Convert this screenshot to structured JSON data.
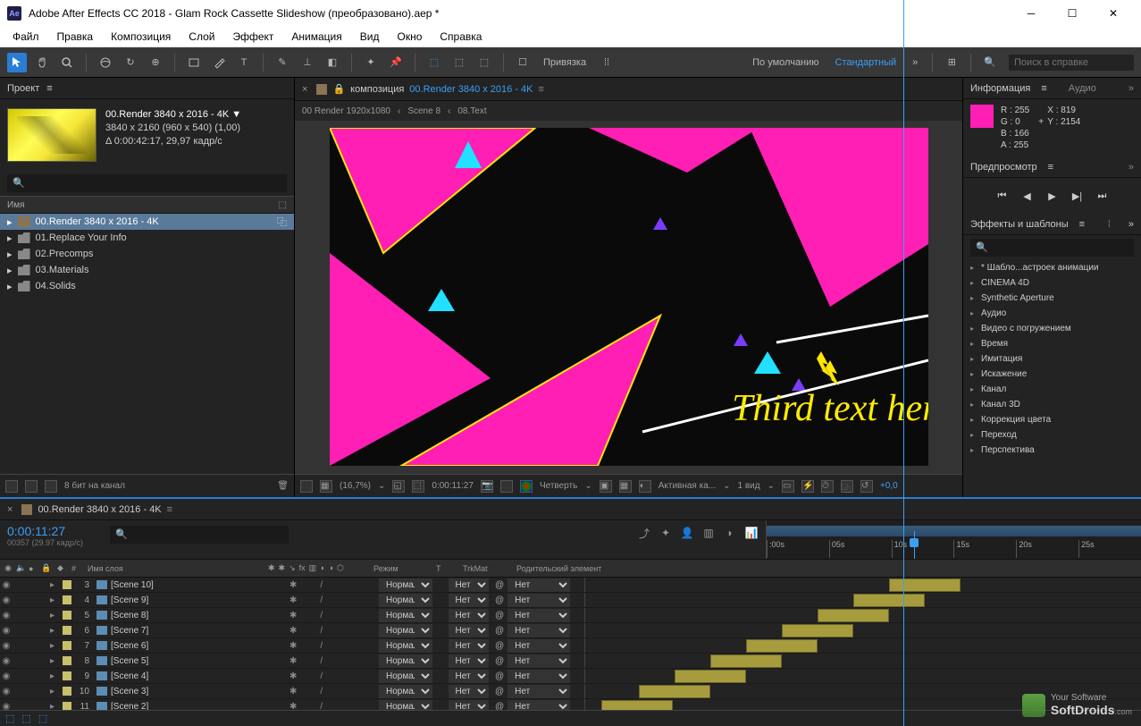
{
  "app": {
    "title": "Adobe After Effects CC 2018 - Glam Rock Cassette Slideshow (преобразовано).aep *"
  },
  "menu": [
    "Файл",
    "Правка",
    "Композиция",
    "Слой",
    "Эффект",
    "Анимация",
    "Вид",
    "Окно",
    "Справка"
  ],
  "toolbar": {
    "snap": "Привязка",
    "workspace_default": "По умолчанию",
    "workspace_standard": "Стандартный",
    "search_placeholder": "Поиск в справке"
  },
  "project": {
    "panel_title": "Проект",
    "selected_name": "00.Render 3840 x 2016 - 4K ▼",
    "dims": "3840 x 2160  (960 x 540) (1,00)",
    "duration": "Δ 0:00:42:17, 29,97 кадр/с",
    "search_placeholder": "",
    "list_header": "Имя",
    "items": [
      {
        "name": "00.Render 3840 x 2016 - 4K",
        "type": "comp",
        "selected": true
      },
      {
        "name": "01.Replace Your Info",
        "type": "folder"
      },
      {
        "name": "02.Precomps",
        "type": "folder"
      },
      {
        "name": "03.Materials",
        "type": "folder"
      },
      {
        "name": "04.Solids",
        "type": "folder"
      }
    ],
    "footer_bpc": "8 бит на канал"
  },
  "comp": {
    "tab_label": "композиция",
    "tab_name": "00.Render 3840 x 2016 - 4K",
    "breadcrumb": [
      "00 Render 1920x1080",
      "Scene 8",
      "08.Text"
    ],
    "overlay_text": "Third text her",
    "zoom": "(16,7%)",
    "time": "0:00:11:27",
    "res": "Четверть",
    "camera": "Активная ка...",
    "views": "1 вид",
    "offset": "+0,0"
  },
  "info": {
    "panel_title": "Информация",
    "audio_tab": "Аудио",
    "r": "255",
    "g": "0",
    "b": "166",
    "a": "255",
    "x": "819",
    "y": "2154"
  },
  "preview": {
    "panel_title": "Предпросмотр"
  },
  "effects": {
    "panel_title": "Эффекты и шаблоны",
    "items": [
      "* Шабло...астроек анимации",
      "CINEMA 4D",
      "Synthetic Aperture",
      "Аудио",
      "Видео с погружением",
      "Время",
      "Имитация",
      "Искажение",
      "Канал",
      "Канал 3D",
      "Коррекция цвета",
      "Переход",
      "Перспектива"
    ]
  },
  "timeline": {
    "tab_name": "00.Render 3840 x 2016 - 4K",
    "timecode": "0:00:11:27",
    "frames": "00357 (29.97 кадр/с)",
    "hdr_name": "Имя слоя",
    "hdr_mode": "Режим",
    "hdr_trkmat": "TrkMat",
    "hdr_parent": "Родительский элемент",
    "mode_value": "Нормаль",
    "none_value": "Нет",
    "ticks": [
      ":00s",
      "05s",
      "10s",
      "15s",
      "20s",
      "25s"
    ],
    "layers": [
      {
        "num": 3,
        "name": "[Scene 10]"
      },
      {
        "num": 4,
        "name": "[Scene 9]"
      },
      {
        "num": 5,
        "name": "[Scene 8]"
      },
      {
        "num": 6,
        "name": "[Scene 7]"
      },
      {
        "num": 7,
        "name": "[Scene 6]"
      },
      {
        "num": 8,
        "name": "[Scene 5]"
      },
      {
        "num": 9,
        "name": "[Scene 4]"
      },
      {
        "num": 10,
        "name": "[Scene 3]"
      },
      {
        "num": 11,
        "name": "[Scene 2]"
      }
    ]
  },
  "watermark": {
    "line1": "Your Software",
    "line2": "SoftDroids",
    "suffix": ".com"
  }
}
